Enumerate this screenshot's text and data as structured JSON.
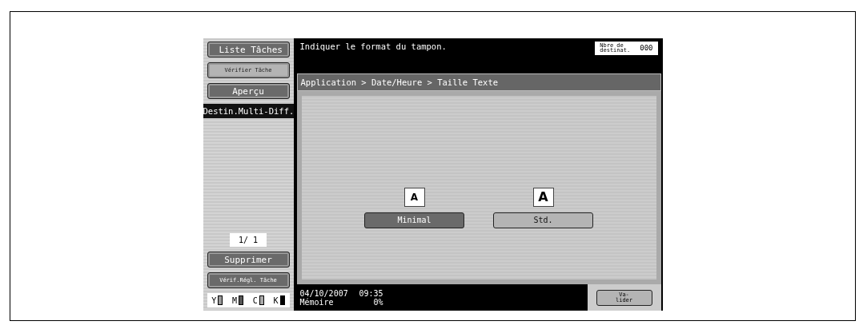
{
  "side_buttons": [
    {
      "label": "Liste Tâches",
      "kind": "large"
    },
    {
      "label": "Vérifier Tâche",
      "kind": "small"
    },
    {
      "label": "Aperçu",
      "kind": "large"
    }
  ],
  "side_label": "Destin.Multi-Diff.",
  "page_counter": "1/ 1",
  "delete_button": "Supprimer",
  "check_button": "Vérif.Régl. Tâche",
  "toners": [
    {
      "label": "Y"
    },
    {
      "label": "M"
    },
    {
      "label": "C"
    },
    {
      "label": "K"
    }
  ],
  "message": "Indiquer le format du tampon.",
  "destinations": {
    "label": "Nbre de destinat.",
    "value": "000"
  },
  "breadcrumb": "Application > Date/Heure > Taille Texte",
  "options": [
    {
      "icon": "A",
      "label": "Minimal",
      "selected": true,
      "kind": "small"
    },
    {
      "icon": "A",
      "label": "Std.",
      "selected": false,
      "kind": "large"
    }
  ],
  "status": {
    "date": "04/10/2007",
    "time": "09:35",
    "memory_label": "Mémoire",
    "memory_value": "0%"
  },
  "ok_button": "Va-lider"
}
